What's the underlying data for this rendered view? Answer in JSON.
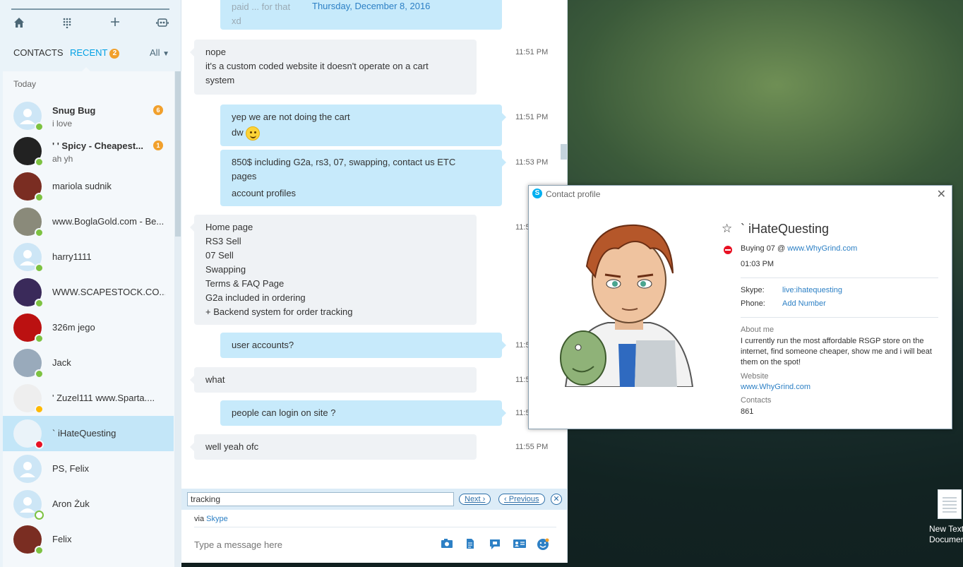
{
  "sidebar": {
    "tabs": {
      "contacts": "CONTACTS",
      "recent": "RECENT",
      "recent_badge": "2",
      "filter": "All"
    },
    "section": "Today",
    "contacts": [
      {
        "name": "Snug Bug",
        "subtitle": "i love",
        "badge": "6",
        "status": "online",
        "bold": true
      },
      {
        "name": "' ' Spicy - Cheapest...",
        "subtitle": "ah yh",
        "badge": "1",
        "status": "online",
        "bold": true
      },
      {
        "name": "mariola sudnik",
        "status": "online"
      },
      {
        "name": "www.BoglaGold.com - Be...",
        "status": "online"
      },
      {
        "name": "harry1111",
        "status": "online"
      },
      {
        "name": "WWW.SCAPESTOCK.CO...",
        "status": "online"
      },
      {
        "name": "326m jego",
        "status": "online"
      },
      {
        "name": "Jack",
        "status": "online"
      },
      {
        "name": "' Zuzel111  www.Sparta....",
        "status": "away"
      },
      {
        "name": "`  iHateQuesting",
        "status": "dnd",
        "selected": true
      },
      {
        "name": "PS, Felix",
        "status": "none"
      },
      {
        "name": "Aron Żuk",
        "status": "offline"
      },
      {
        "name": "Felix",
        "status": "online"
      }
    ]
  },
  "chat": {
    "date": "Thursday, December 8, 2016",
    "partial_top": [
      "paid ... for that",
      "xd"
    ],
    "messages": [
      {
        "dir": "in",
        "lines": [
          "nope",
          "it's a custom coded website it doesn't operate on a cart",
          "system"
        ],
        "time": "11:51 PM"
      },
      {
        "dir": "out",
        "lines": [
          "yep we are not doing the cart",
          "dw"
        ],
        "time": "11:51 PM"
      },
      {
        "dir": "out",
        "lines": [
          "850$ including G2a, rs3, 07, swapping, contact us ETC",
          "pages",
          "account profiles"
        ],
        "time": "11:53 PM"
      },
      {
        "dir": "in",
        "lines": [
          "Home page",
          "RS3 Sell",
          "07 Sell",
          "Swapping",
          "Terms & FAQ Page",
          "G2a included in ordering",
          "+ Backend system for order tracking"
        ],
        "time": "11:5"
      },
      {
        "dir": "out",
        "lines": [
          "user accounts?"
        ],
        "time": "11:5"
      },
      {
        "dir": "in",
        "lines": [
          "what"
        ],
        "time": "11:5"
      },
      {
        "dir": "out",
        "lines": [
          "people can login on site ?"
        ],
        "time": "11:5"
      },
      {
        "dir": "in",
        "lines": [
          "well yeah ofc"
        ],
        "time": "11:55 PM"
      }
    ],
    "find": {
      "value": "tracking",
      "next": "Next",
      "previous": "Previous"
    },
    "via_prefix": "via",
    "via_link": "Skype",
    "composer_placeholder": "Type a message here"
  },
  "profile": {
    "window_title": "Contact profile",
    "name": "`  iHateQuesting",
    "mood_text": "Buying 07  @",
    "mood_link": "www.WhyGrind.com",
    "local_time": "01:03 PM",
    "skype_label": "Skype:",
    "skype_value": "live:ihatequesting",
    "phone_label": "Phone:",
    "phone_value": "Add Number",
    "about_label": "About me",
    "about_text": "I currently run the most affordable RSGP store on the internet, find someone cheaper, show me and i will beat them on the spot!",
    "website_label": "Website",
    "website_value": "www.WhyGrind.com",
    "contacts_label": "Contacts",
    "contacts_value": "861"
  },
  "desktop": {
    "icon_label": "New Text Document"
  },
  "colors": {
    "accent": "#00a0e4",
    "bubble_out": "#c7eafb",
    "bubble_in": "#eff2f5",
    "badge": "#f1a02c"
  }
}
